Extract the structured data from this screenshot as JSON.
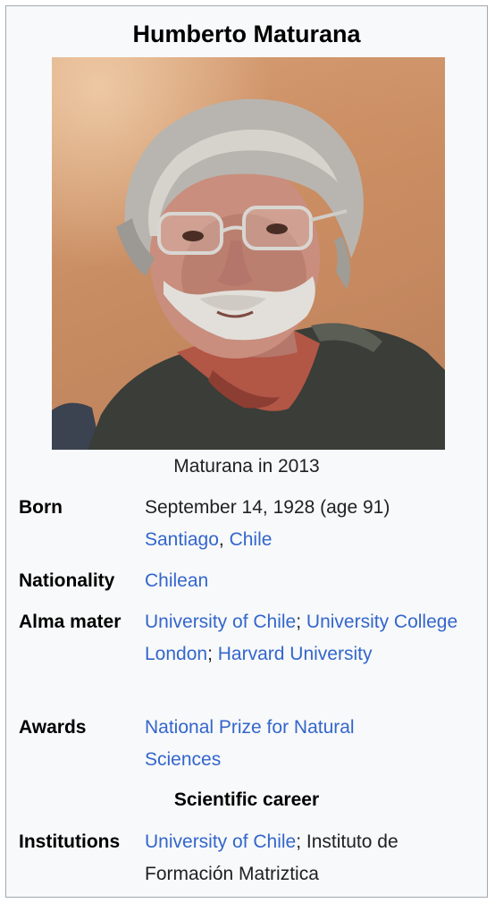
{
  "infobox": {
    "title": "Humberto Maturana",
    "image_caption": "Maturana in 2013",
    "born": {
      "label": "Born",
      "date": "September 14, 1928 (age 91)",
      "city": "Santiago",
      "sep": ", ",
      "country": "Chile"
    },
    "nationality": {
      "label": "Nationality",
      "value": "Chilean"
    },
    "alma_mater": {
      "label": "Alma mater",
      "school1": "University of Chile",
      "sep1": "; ",
      "school2": "University College London",
      "sep2": "; ",
      "school3": "Harvard University"
    },
    "awards": {
      "label": "Awards",
      "value": "National Prize for Natural Sciences"
    },
    "section_header": "Scientific career",
    "institutions": {
      "label": "Institutions",
      "inst1": "University of Chile",
      "sep": "; ",
      "inst2": "Instituto de Formación Matriztica"
    }
  },
  "colors": {
    "link": "#3366cc",
    "border": "#a2a9b1",
    "background": "#f8f9fa"
  }
}
